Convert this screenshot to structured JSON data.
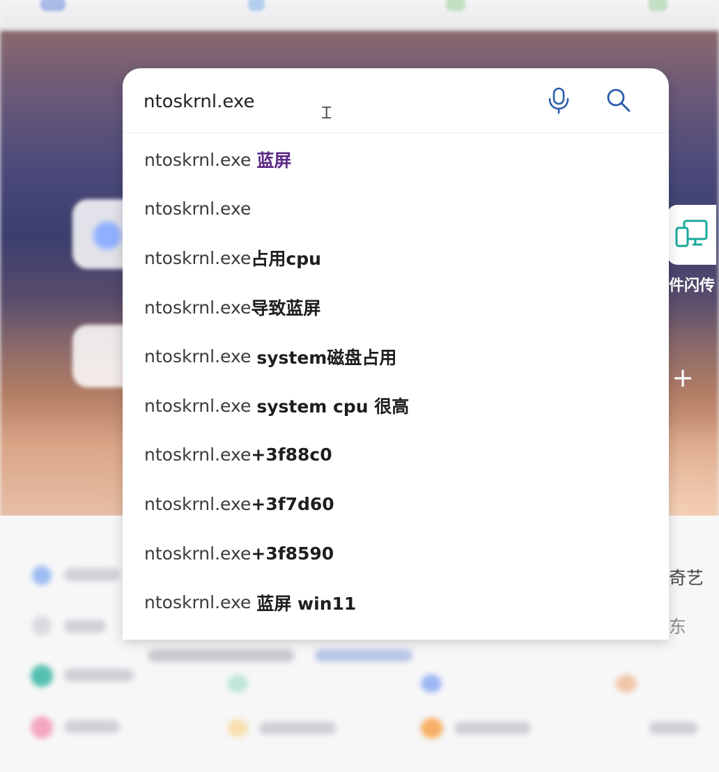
{
  "search": {
    "query": "ntoskrnl.exe"
  },
  "icons": {
    "mic": "microphone-icon",
    "search": "search-icon",
    "screen": "dual-screen-icon"
  },
  "suggestions": [
    {
      "base": "ntoskrnl.exe ",
      "completion": "蓝屏",
      "visited": true
    },
    {
      "base": "ntoskrnl.exe",
      "completion": "",
      "visited": false
    },
    {
      "base": "ntoskrnl.exe",
      "completion": "占用cpu",
      "visited": false
    },
    {
      "base": "ntoskrnl.exe",
      "completion": "导致蓝屏",
      "visited": false
    },
    {
      "base": "ntoskrnl.exe ",
      "completion": "system磁盘占用",
      "visited": false
    },
    {
      "base": "ntoskrnl.exe ",
      "completion": "system cpu 很高",
      "visited": false
    },
    {
      "base": "ntoskrnl.exe",
      "completion": "+3f88c0",
      "visited": false
    },
    {
      "base": "ntoskrnl.exe",
      "completion": "+3f7d60",
      "visited": false
    },
    {
      "base": "ntoskrnl.exe",
      "completion": "+3f8590",
      "visited": false
    },
    {
      "base": "ntoskrnl.exe ",
      "completion": "蓝屏 win11",
      "visited": false
    }
  ],
  "background": {
    "side_caption": "件闪传",
    "plus": "+",
    "side_text_1": "奇艺",
    "side_text_2": "东"
  },
  "colors": {
    "visited_completion": "#5b2a86",
    "accent_teal": "#1aa89a"
  }
}
